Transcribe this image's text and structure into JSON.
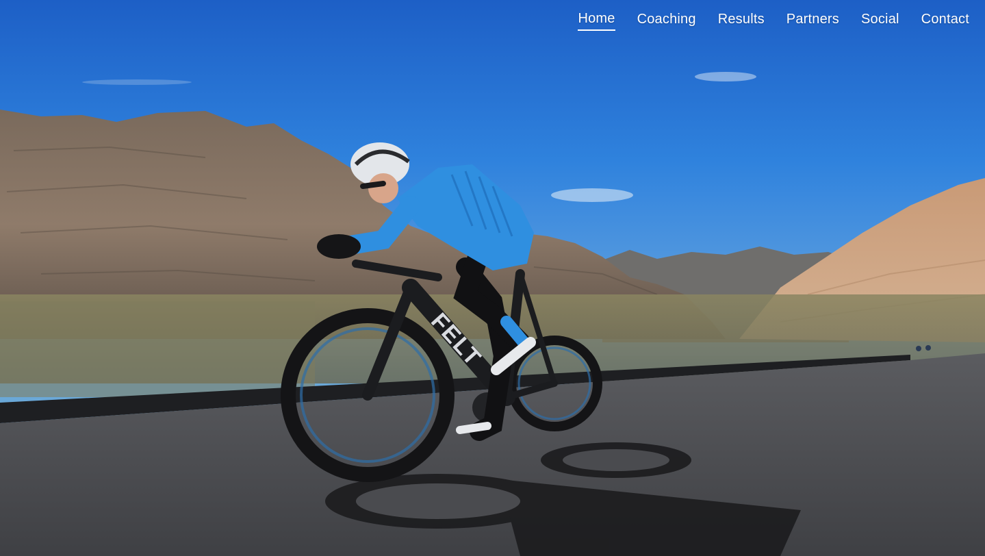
{
  "nav": {
    "items": [
      {
        "label": "Home",
        "active": true
      },
      {
        "label": "Coaching",
        "active": false
      },
      {
        "label": "Results",
        "active": false
      },
      {
        "label": "Partners",
        "active": false
      },
      {
        "label": "Social",
        "active": false
      },
      {
        "label": "Contact",
        "active": false
      }
    ]
  },
  "hero": {
    "bike_brand": "FELT"
  },
  "colors": {
    "nav_text": "#ffffff",
    "sky": "#2a76d8",
    "road": "#4a4b4f",
    "jersey": "#2f8fe0"
  }
}
